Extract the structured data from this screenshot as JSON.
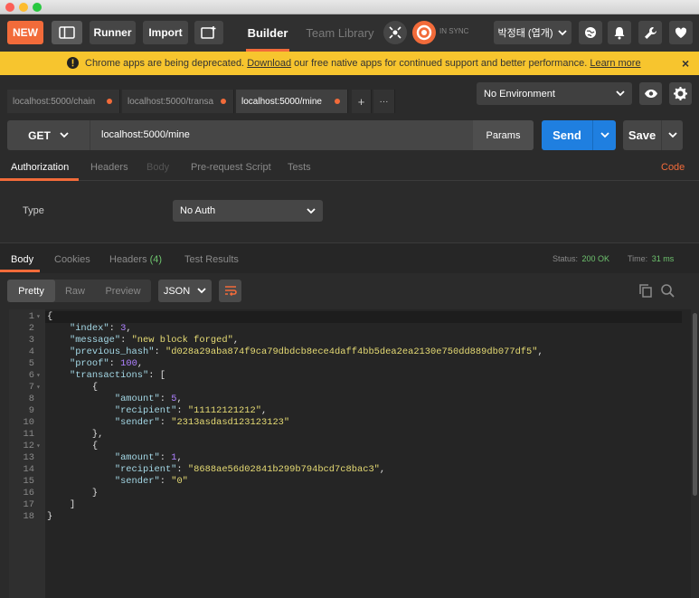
{
  "toolbar": {
    "new_label": "NEW",
    "runner_label": "Runner",
    "import_label": "Import",
    "builder_label": "Builder",
    "team_library_label": "Team Library",
    "sync_label": "IN SYNC",
    "user_label": "박정태 (엽개)"
  },
  "banner": {
    "text_before": "Chrome apps are being deprecated.",
    "download_link": "Download",
    "text_after": "our free native apps for continued support and better performance.",
    "learn_more_link": "Learn more",
    "close": "×"
  },
  "tabs": [
    {
      "label": "localhost:5000/chain"
    },
    {
      "label": "localhost:5000/transa"
    },
    {
      "label": "localhost:5000/mine"
    }
  ],
  "tabs_add": "+",
  "tabs_more": "···",
  "environment": {
    "selected": "No Environment"
  },
  "request": {
    "method": "GET",
    "url": "localhost:5000/mine",
    "params_label": "Params",
    "send_label": "Send",
    "save_label": "Save"
  },
  "request_tabs": {
    "authorization": "Authorization",
    "headers": "Headers",
    "body": "Body",
    "prerequest": "Pre-request Script",
    "tests": "Tests",
    "code": "Code"
  },
  "auth": {
    "type_label": "Type",
    "type_value": "No Auth"
  },
  "response_tabs": {
    "body": "Body",
    "cookies": "Cookies",
    "headers": "Headers",
    "headers_count": "(4)",
    "test_results": "Test Results"
  },
  "response_status": {
    "status_label": "Status:",
    "status_value": "200 OK",
    "time_label": "Time:",
    "time_value": "31 ms"
  },
  "view": {
    "pretty": "Pretty",
    "raw": "Raw",
    "preview": "Preview",
    "format": "JSON"
  },
  "colors": {
    "accent_orange": "#f26b3a",
    "send_blue": "#1f7fe0",
    "status_green": "#6ec36e",
    "banner_yellow": "#f7c52e"
  },
  "code_lines": [
    {
      "n": "1",
      "fold": true
    },
    {
      "n": "2"
    },
    {
      "n": "3"
    },
    {
      "n": "4"
    },
    {
      "n": "5"
    },
    {
      "n": "6",
      "fold": true
    },
    {
      "n": "7",
      "fold": true
    },
    {
      "n": "8"
    },
    {
      "n": "9"
    },
    {
      "n": "10"
    },
    {
      "n": "11"
    },
    {
      "n": "12",
      "fold": true
    },
    {
      "n": "13"
    },
    {
      "n": "14"
    },
    {
      "n": "15"
    },
    {
      "n": "16"
    },
    {
      "n": "17"
    },
    {
      "n": "18"
    }
  ],
  "response_json": {
    "index": "3",
    "message": "\"new block forged\"",
    "previous_hash": "\"d028a29aba874f9ca79dbdcb8ece4daff4bb5dea2ea2130e750dd889db077df5\"",
    "proof": "100",
    "tx1_amount": "5",
    "tx1_recipient": "\"11112121212\"",
    "tx1_sender": "\"2313asdasd123123123\"",
    "tx2_amount": "1",
    "tx2_recipient": "\"8688ae56d02841b299b794bcd7c8bac3\"",
    "tx2_sender": "\"0\""
  }
}
